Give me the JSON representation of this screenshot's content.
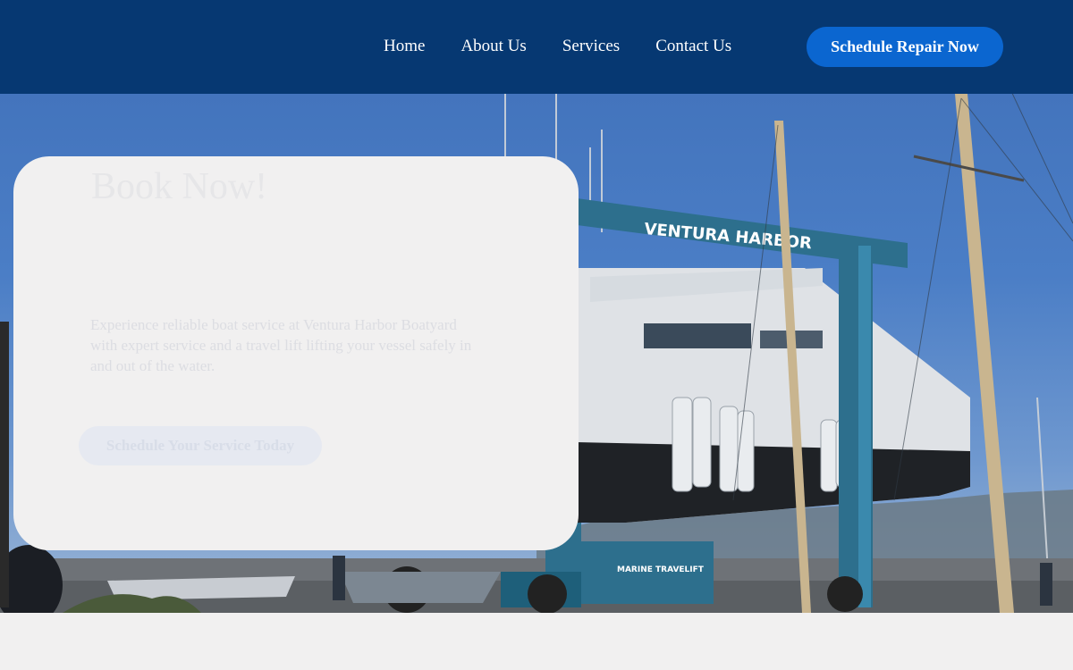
{
  "header": {
    "nav": [
      {
        "label": "Home"
      },
      {
        "label": "About Us"
      },
      {
        "label": "Services"
      },
      {
        "label": "Contact Us"
      }
    ],
    "cta_label": "Schedule Repair Now"
  },
  "hero": {
    "title_line_tail": "Book Now!",
    "description": "Experience reliable boat service at Ventura Harbor Boatyard with expert service and a travel lift lifting your vessel safely in and out of the water.",
    "button_label": "Schedule Your Service Today",
    "scene": {
      "gantry_sign": "VENTURA HARBOR",
      "lift_brand": "MARINE TRAVELIFT",
      "colors": {
        "sky": "#4b7ec6",
        "gantry": "#2d6f8d",
        "hull": "#dfe2e6",
        "mast": "#c9b58f"
      }
    }
  },
  "colors": {
    "header_bg": "#063872",
    "cta_bg": "#0b66d0",
    "card_bg": "#f1f0f0"
  }
}
